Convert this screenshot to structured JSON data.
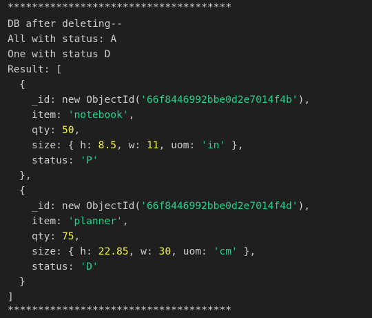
{
  "terminal": {
    "separator": "*************************************",
    "header_line1": "DB after deleting--",
    "header_line2": "All with status: A",
    "header_line3": "One with status D",
    "result_open": "Result: [",
    "close_bracket": "]",
    "records": [
      {
        "open": "{",
        "id_label": "_id: new ObjectId(",
        "id_value": "'66f8446992bbe0d2e7014f4b'",
        "id_close": "),",
        "item_label": "item: ",
        "item_value": "'notebook'",
        "item_comma": ",",
        "qty_label": "qty: ",
        "qty_value": "50",
        "qty_comma": ",",
        "size_open": "size: { h: ",
        "size_h": "8.5",
        "size_w_label": ", w: ",
        "size_w": "11",
        "size_uom_label": ", uom: ",
        "size_uom": "'in'",
        "size_close": " },",
        "status_label": "status: ",
        "status_value": "'P'",
        "close": "},"
      },
      {
        "open": "{",
        "id_label": "_id: new ObjectId(",
        "id_value": "'66f8446992bbe0d2e7014f4d'",
        "id_close": "),",
        "item_label": "item: ",
        "item_value": "'planner'",
        "item_comma": ",",
        "qty_label": "qty: ",
        "qty_value": "75",
        "qty_comma": ",",
        "size_open": "size: { h: ",
        "size_h": "22.85",
        "size_w_label": ", w: ",
        "size_w": "30",
        "size_uom_label": ", uom: ",
        "size_uom": "'cm'",
        "size_close": " },",
        "status_label": "status: ",
        "status_value": "'D'",
        "close": "}"
      }
    ],
    "colors": {
      "background": "#1f1f1f",
      "text": "#cccccc",
      "string": "#23d18b",
      "number": "#f5f543"
    }
  }
}
